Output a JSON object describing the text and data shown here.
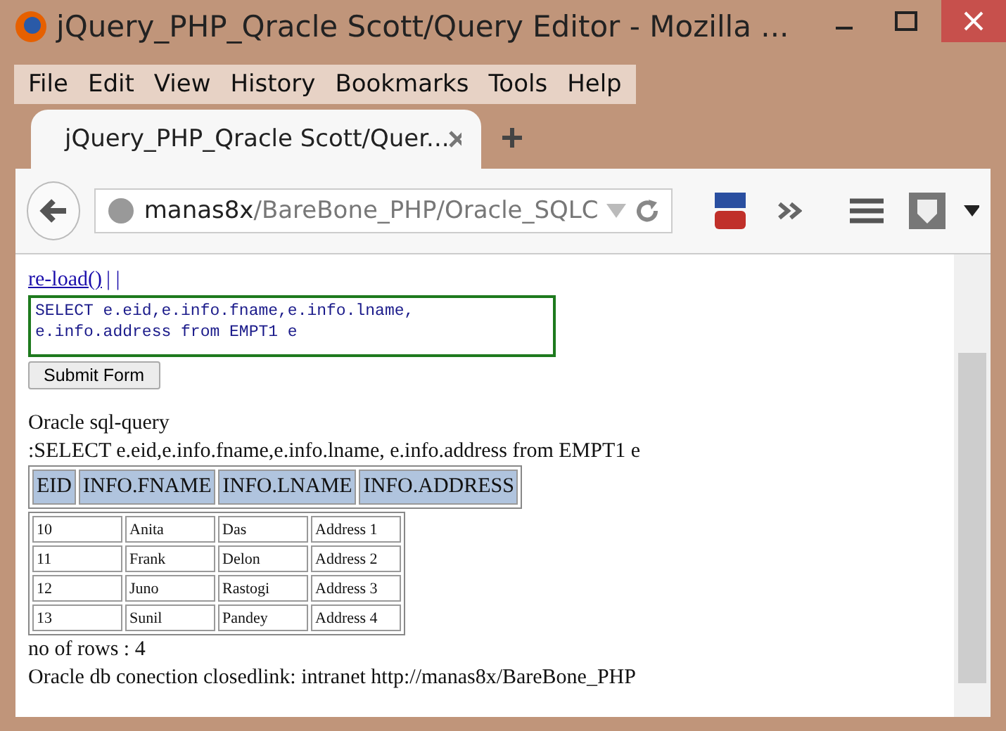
{
  "window": {
    "title": "jQuery_PHP_Qracle Scott/Query Editor - Mozilla ..."
  },
  "menu": [
    {
      "label": "File"
    },
    {
      "label": "Edit"
    },
    {
      "label": "View"
    },
    {
      "label": "History"
    },
    {
      "label": "Bookmarks"
    },
    {
      "label": "Tools"
    },
    {
      "label": "Help"
    }
  ],
  "tabs": [
    {
      "label": "jQuery_PHP_Qracle Scott/Quer...",
      "selected": true
    }
  ],
  "address_bar": {
    "host": "manas8x",
    "path": "/BareBone_PHP/Oracle_SQLC"
  },
  "page": {
    "reload_link": "re-load()",
    "separators": "| |",
    "query_field": {
      "value": "SELECT e.eid,e.info.fname,e.info.lname,\ne.info.address from EMPT1 e"
    },
    "submit_button": "Submit Form",
    "heading": "Oracle sql-query",
    "query_text": ":SELECT e.eid,e.info.fname,e.info.lname, e.info.address from EMPT1 e",
    "table": {
      "columns": [
        "EID",
        "INFO.FNAME",
        "INFO.LNAME",
        "INFO.ADDRESS"
      ],
      "rows": [
        [
          "10",
          "Anita",
          "Das",
          "Address 1"
        ],
        [
          "11",
          "Frank",
          "Delon",
          "Address 2"
        ],
        [
          "12",
          "Juno",
          "Rastogi",
          "Address 3"
        ],
        [
          "13",
          "Sunil",
          "Pandey",
          "Address 4"
        ]
      ]
    },
    "row_count": "no of rows : 4",
    "status": "Oracle db conection closedlink: intranet http://manas8x/BareBone_PHP"
  }
}
